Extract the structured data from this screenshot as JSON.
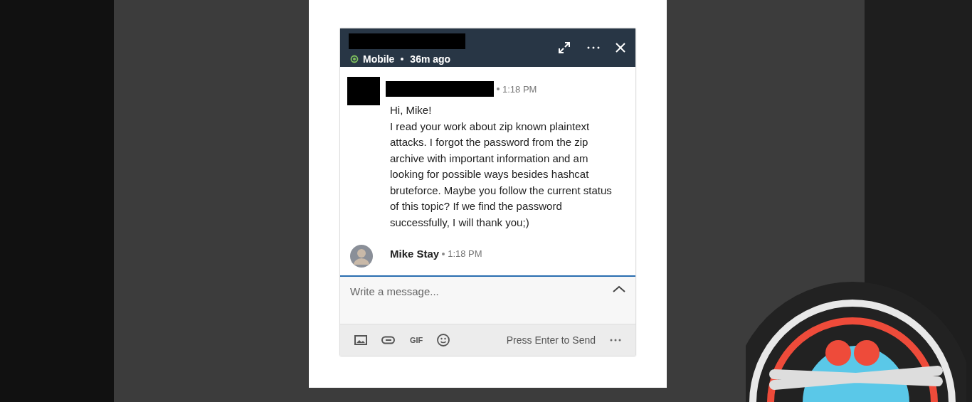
{
  "chat": {
    "header": {
      "presence": "Mobile",
      "last_seen": "36m ago"
    },
    "messages": [
      {
        "kind": "redacted",
        "time": "1:18 PM",
        "paragraphs": [
          "Hi, Mike!",
          "I read your work about zip known plaintext attacks. I forgot the password from the zip archive with important information and am looking for possible ways besides hashcat bruteforce. Maybe you follow the current status of this topic? If we find the password successfully, I will thank you;)"
        ]
      },
      {
        "kind": "named",
        "sender": "Mike Stay",
        "time": "1:18 PM"
      }
    ],
    "composer": {
      "placeholder": "Write a message..."
    },
    "toolbar": {
      "gif": "GIF",
      "hint": "Press Enter to Send"
    }
  }
}
